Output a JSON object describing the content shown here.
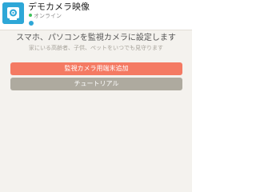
{
  "camera": {
    "name": "デモカメラ映像",
    "status": "オンライン",
    "status_color": "#3ec35b",
    "icon": "camera-icon",
    "icon_bg_color": "#2ea7d7"
  },
  "setup": {
    "title": "スマホ、パソコンを監視カメラに設定します",
    "subtitle": "家にいる高齢者、子供、ペットをいつでも見守ります",
    "add_button_label": "監視カメラ用端末追加",
    "add_button_color": "#f47a63",
    "tutorial_button_label": "チュートリアル",
    "tutorial_button_color": "#aeaa9f"
  }
}
